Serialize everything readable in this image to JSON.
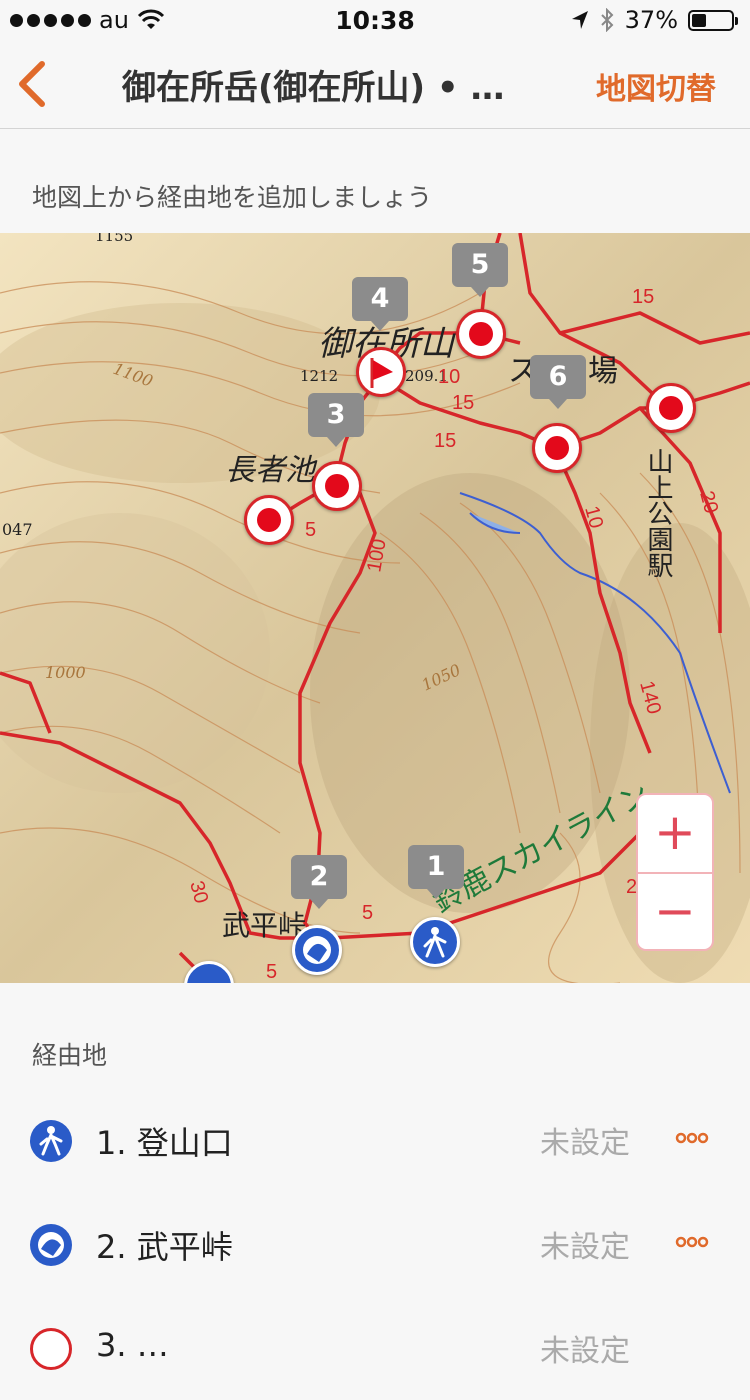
{
  "status_bar": {
    "carrier": "au",
    "time": "10:38",
    "battery": "37%",
    "battery_level": 0.37
  },
  "navbar": {
    "back_icon": "chevron-left-icon",
    "title": "御在所岳(御在所山) • …",
    "switch_map_label": "地図切替"
  },
  "hint_text": "地図上から経由地を追加しましょう",
  "map": {
    "labels": {
      "peak": "御在所山",
      "pond": "長者池",
      "pass": "武平峠",
      "station": "山上公園駅",
      "skyline": "鈴鹿スカイライン",
      "slope_fragment": "ス",
      "slope_fragment2": "場",
      "elev_1212": "1212",
      "elev_209": "209.1",
      "elev_1155": "1155",
      "elev_047": "047",
      "elev_1000": "1000",
      "elev_1050": "1050",
      "elev_1100": "1100"
    },
    "route_times": [
      "15",
      "10",
      "15",
      "15",
      "5",
      "5",
      "5",
      "5",
      "2"
    ],
    "route_arrows": [
      "100",
      "10",
      "140",
      "30",
      "20"
    ],
    "numbered_markers": [
      "1",
      "2",
      "3",
      "4",
      "5",
      "6"
    ],
    "zoom_in": "+",
    "zoom_out": "−",
    "colors": {
      "route": "#d7262a",
      "trailhead": "#2a5bc8",
      "waypoint": "#e3091b"
    }
  },
  "waypoints": {
    "section_title": "経由地",
    "items": [
      {
        "label": "1. 登山口",
        "status": "未設定",
        "icon": "hiker-icon"
      },
      {
        "label": "2. 武平峠",
        "status": "未設定",
        "icon": "pass-icon"
      },
      {
        "label": "3. …",
        "status": "未設定",
        "icon": "waypoint-icon"
      }
    ]
  },
  "accent_color": "#e06a2b"
}
